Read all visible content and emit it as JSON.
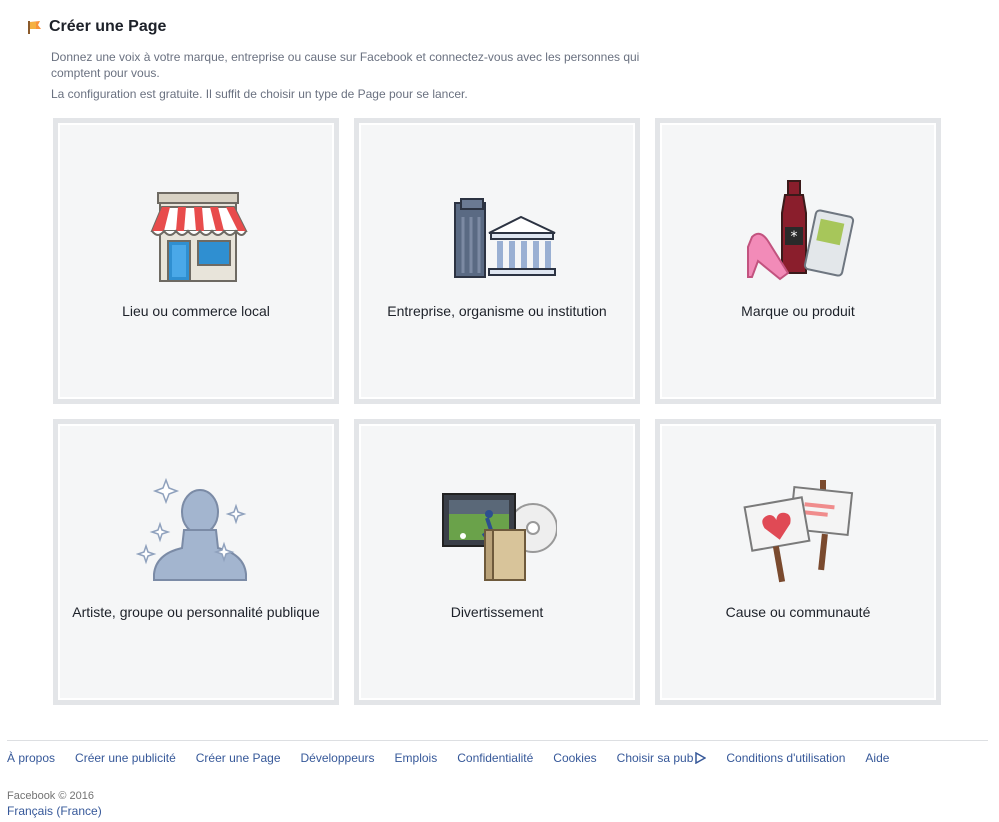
{
  "header": {
    "title": "Créer une Page",
    "description": "Donnez une voix à votre marque, entreprise ou cause sur Facebook et connectez-vous avec les personnes qui comptent pour vous.",
    "subdescription": "La configuration est gratuite. Il suffit de choisir un type de Page pour se lancer."
  },
  "categories": [
    {
      "label": "Lieu ou commerce local",
      "icon": "storefront-icon"
    },
    {
      "label": "Entreprise, organisme ou institution",
      "icon": "building-bank-icon"
    },
    {
      "label": "Marque ou produit",
      "icon": "product-bottle-shoe-icon"
    },
    {
      "label": "Artiste, groupe ou personnalité publique",
      "icon": "person-sparkles-icon"
    },
    {
      "label": "Divertissement",
      "icon": "tv-book-disc-icon"
    },
    {
      "label": "Cause ou communauté",
      "icon": "protest-signs-icon"
    }
  ],
  "footer": {
    "links": [
      "À propos",
      "Créer une publicité",
      "Créer une Page",
      "Développeurs",
      "Emplois",
      "Confidentialité",
      "Cookies",
      "Choisir sa pub",
      "Conditions d'utilisation",
      "Aide"
    ],
    "copyright": "Facebook © 2016",
    "language": "Français (France)"
  },
  "colors": {
    "link": "#365899",
    "card_bg": "#f5f6f7",
    "card_border": "#e3e5e8",
    "muted_text": "#6a7180"
  }
}
